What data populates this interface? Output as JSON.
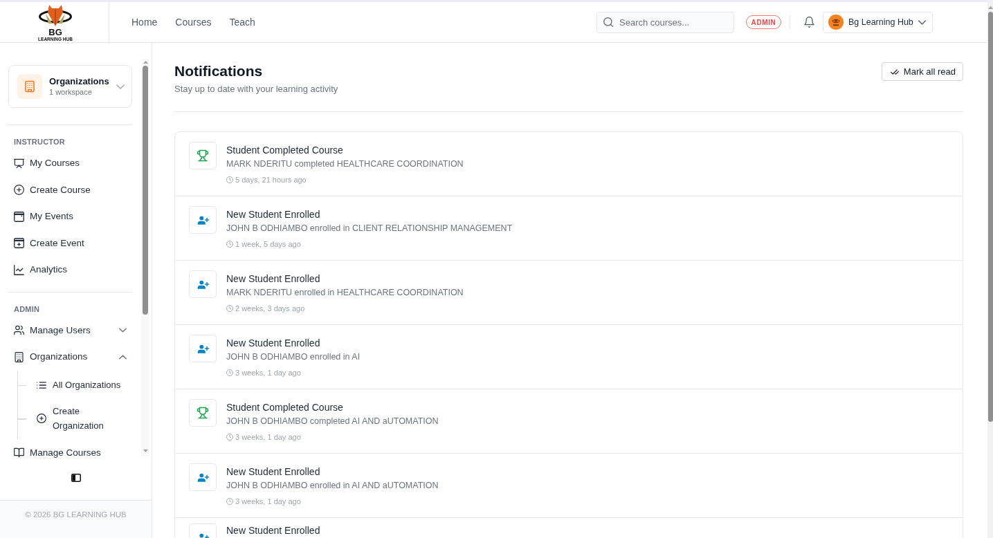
{
  "header": {
    "logo": {
      "title": "BG",
      "subtitle": "LEARNING HUB"
    },
    "nav": [
      {
        "label": "Home"
      },
      {
        "label": "Courses"
      },
      {
        "label": "Teach"
      }
    ],
    "search": {
      "placeholder": "Search courses..."
    },
    "role_badge": "ADMIN",
    "account": {
      "name": "Bg Learning Hub"
    }
  },
  "sidebar": {
    "workspace": {
      "title": "Organizations",
      "subtitle": "1 workspace",
      "expanded": false
    },
    "sections": [
      {
        "heading": "INSTRUCTOR",
        "items": [
          {
            "label": "My Courses"
          },
          {
            "label": "Create Course"
          },
          {
            "label": "My Events"
          },
          {
            "label": "Create Event"
          },
          {
            "label": "Analytics"
          }
        ]
      },
      {
        "heading": "ADMIN",
        "items": [
          {
            "label": "Manage Users",
            "expanded": false
          },
          {
            "label": "Organizations",
            "expanded": true,
            "children": [
              {
                "label": "All Organizations"
              },
              {
                "label": "Create Organization"
              }
            ]
          },
          {
            "label": "Manage Courses"
          }
        ]
      }
    ],
    "footer": "© 2026 BG LEARNING HUB"
  },
  "main": {
    "title": "Notifications",
    "subtitle": "Stay up to date with your learning activity",
    "mark_all_button": "Mark all read",
    "notifications": [
      {
        "kind": "completed",
        "title": "Student Completed Course",
        "message": "MARK NDERITU completed HEALTHCARE COORDINATION",
        "time": "5 days, 21 hours ago"
      },
      {
        "kind": "enrolled",
        "title": "New Student Enrolled",
        "message": "JOHN B ODHIAMBO enrolled in CLIENT RELATIONSHIP MANAGEMENT",
        "time": "1 week, 5 days ago"
      },
      {
        "kind": "enrolled",
        "title": "New Student Enrolled",
        "message": "MARK NDERITU enrolled in HEALTHCARE COORDINATION",
        "time": "2 weeks, 3 days ago"
      },
      {
        "kind": "enrolled",
        "title": "New Student Enrolled",
        "message": "JOHN B ODHIAMBO enrolled in AI",
        "time": "3 weeks, 1 day ago"
      },
      {
        "kind": "completed",
        "title": "Student Completed Course",
        "message": "JOHN B ODHIAMBO completed AI AND aUTOMATION",
        "time": "3 weeks, 1 day ago"
      },
      {
        "kind": "enrolled",
        "title": "New Student Enrolled",
        "message": "JOHN B ODHIAMBO enrolled in AI AND aUTOMATION",
        "time": "3 weeks, 1 day ago"
      },
      {
        "kind": "enrolled",
        "title": "New Student Enrolled"
      }
    ]
  }
}
